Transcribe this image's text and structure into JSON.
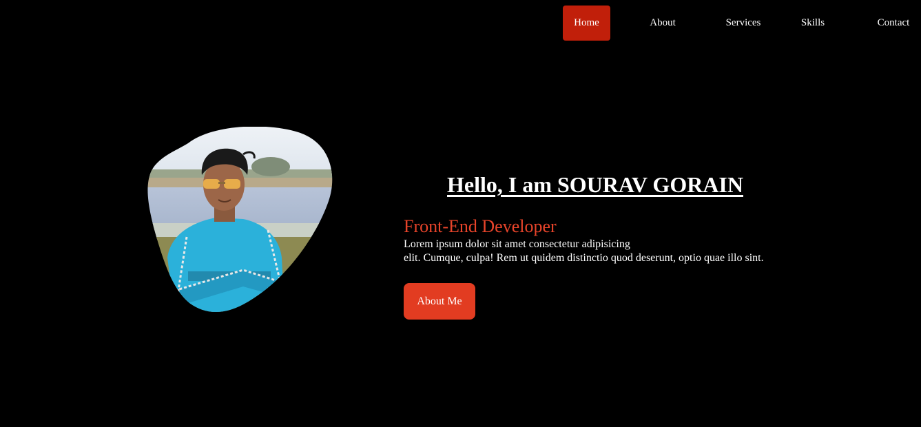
{
  "nav": {
    "items": [
      {
        "label": "Home",
        "active": true
      },
      {
        "label": "About",
        "active": false
      },
      {
        "label": "Services",
        "active": false
      },
      {
        "label": "Skills",
        "active": false
      },
      {
        "label": "Contact",
        "active": false
      }
    ]
  },
  "hero": {
    "title": "Hello, I am SOURAV GORAIN",
    "role": "Front-End Developer",
    "desc_line1": "Lorem ipsum dolor sit amet consectetur adipisicing",
    "desc_line2": "elit. Cumque, culpa! Rem ut quidem distinctio quod deserunt, optio quae illo sint.",
    "button_label": "About Me"
  },
  "colors": {
    "background": "#000000",
    "nav_active": "#c11f0a",
    "accent": "#e8442a",
    "button": "#e23c21"
  }
}
